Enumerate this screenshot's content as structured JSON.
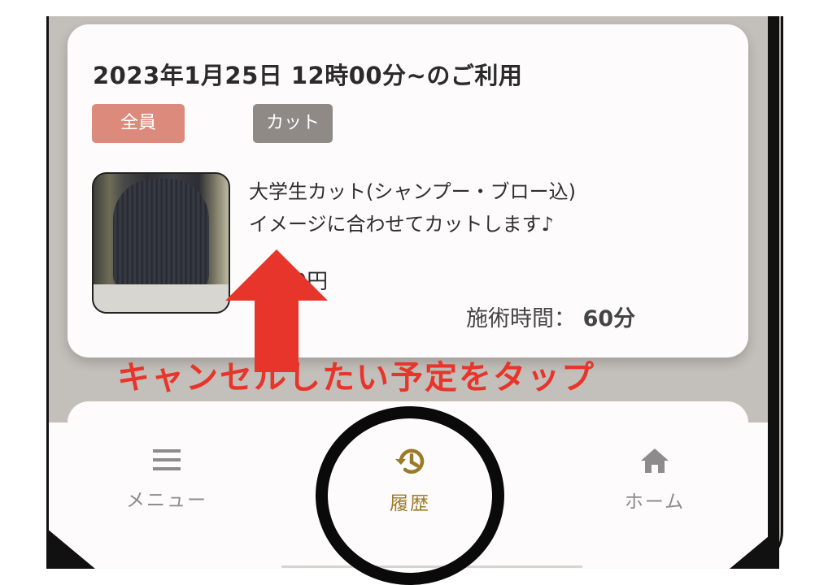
{
  "reservation": {
    "title": "2023年1月25日 12時00分~のご利用",
    "tags": {
      "target": "全員",
      "category": "カット"
    },
    "description_line1": "大学生カット(シャンプー・ブロー込)",
    "description_line2": "イメージに合わせてカットします♪",
    "price_visible": "00円",
    "duration_label": "施術時間：",
    "duration_value": "60分"
  },
  "annotation": {
    "instruction": "キャンセルしたい予定をタップ",
    "arrow_color": "#e8352b",
    "circle_color": "#0a0a0a"
  },
  "bottom_nav": {
    "items": [
      {
        "label": "メニュー",
        "icon": "menu-icon"
      },
      {
        "label": "履歴",
        "icon": "history-icon",
        "active": true
      },
      {
        "label": "ホーム",
        "icon": "home-icon"
      }
    ],
    "active_color": "#9a7b28",
    "inactive_color": "#8c8c8c"
  }
}
